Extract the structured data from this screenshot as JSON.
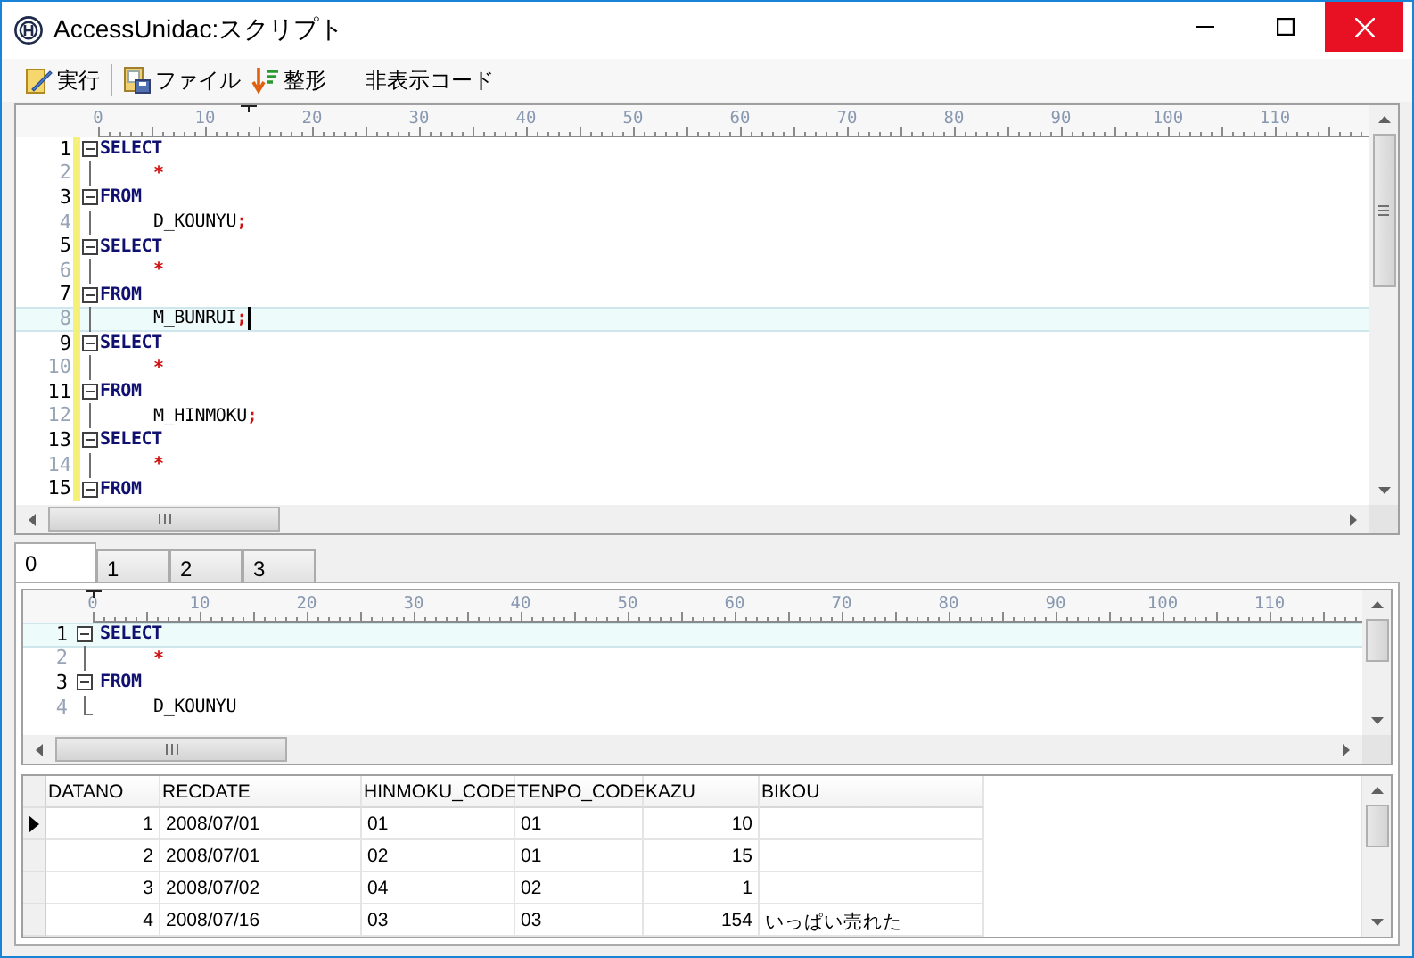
{
  "window": {
    "title": "AccessUnidac:スクリプト"
  },
  "toolbar": [
    {
      "label": "実行",
      "kind": "run"
    },
    {
      "label": "ファイル",
      "kind": "file"
    },
    {
      "label": "整形",
      "kind": "format"
    },
    {
      "label": "非表示コード",
      "kind": "plain"
    }
  ],
  "editor": {
    "change_bar": true,
    "caret": true,
    "ruler": [
      "0",
      "10",
      "20",
      "30",
      "40",
      "50",
      "60",
      "70",
      "80",
      "90",
      "100",
      "110"
    ],
    "lines": [
      {
        "no": "1",
        "kind": "head",
        "current": false,
        "tokens": [
          {
            "kind": "keyword",
            "text": "SELECT"
          }
        ]
      },
      {
        "no": "2",
        "kind": "body",
        "current": false,
        "tokens": [
          {
            "kind": "symbol",
            "text": "*"
          }
        ]
      },
      {
        "no": "3",
        "kind": "head",
        "current": false,
        "tokens": [
          {
            "kind": "keyword",
            "text": "FROM"
          }
        ]
      },
      {
        "no": "4",
        "kind": "body",
        "current": false,
        "tokens": [
          {
            "kind": "ident",
            "text": "D_KOUNYU"
          },
          {
            "kind": "symbol",
            "text": ";"
          }
        ]
      },
      {
        "no": "5",
        "kind": "head",
        "current": false,
        "tokens": [
          {
            "kind": "keyword",
            "text": "SELECT"
          }
        ]
      },
      {
        "no": "6",
        "kind": "body",
        "current": false,
        "tokens": [
          {
            "kind": "symbol",
            "text": "*"
          }
        ]
      },
      {
        "no": "7",
        "kind": "head",
        "current": false,
        "tokens": [
          {
            "kind": "keyword",
            "text": "FROM"
          }
        ]
      },
      {
        "no": "8",
        "kind": "body",
        "current": true,
        "tokens": [
          {
            "kind": "ident",
            "text": "M_BUNRUI"
          },
          {
            "kind": "symbol",
            "text": ";"
          }
        ]
      },
      {
        "no": "9",
        "kind": "head",
        "current": false,
        "tokens": [
          {
            "kind": "keyword",
            "text": "SELECT"
          }
        ]
      },
      {
        "no": "10",
        "kind": "body",
        "current": false,
        "tokens": [
          {
            "kind": "symbol",
            "text": "*"
          }
        ]
      },
      {
        "no": "11",
        "kind": "head",
        "current": false,
        "tokens": [
          {
            "kind": "keyword",
            "text": "FROM"
          }
        ]
      },
      {
        "no": "12",
        "kind": "body",
        "current": false,
        "tokens": [
          {
            "kind": "ident",
            "text": "M_HINMOKU"
          },
          {
            "kind": "symbol",
            "text": ";"
          }
        ]
      },
      {
        "no": "13",
        "kind": "head",
        "current": false,
        "tokens": [
          {
            "kind": "keyword",
            "text": "SELECT"
          }
        ]
      },
      {
        "no": "14",
        "kind": "body",
        "current": false,
        "tokens": [
          {
            "kind": "symbol",
            "text": "*"
          }
        ]
      },
      {
        "no": "15",
        "kind": "head",
        "current": false,
        "tokens": [
          {
            "kind": "keyword",
            "text": "FROM"
          }
        ]
      }
    ]
  },
  "result_tabs": [
    {
      "label": "0",
      "selected": true
    },
    {
      "label": "1",
      "selected": false
    },
    {
      "label": "2",
      "selected": false
    },
    {
      "label": "3",
      "selected": false
    }
  ],
  "result_editor": {
    "change_bar": false,
    "caret": false,
    "ruler": [
      "0",
      "10",
      "20",
      "30",
      "40",
      "50",
      "60",
      "70",
      "80",
      "90",
      "100",
      "110"
    ],
    "lines": [
      {
        "no": "1",
        "kind": "head",
        "current": true,
        "tokens": [
          {
            "kind": "keyword",
            "text": "SELECT"
          }
        ]
      },
      {
        "no": "2",
        "kind": "body",
        "current": false,
        "tokens": [
          {
            "kind": "symbol",
            "text": "*"
          }
        ]
      },
      {
        "no": "3",
        "kind": "head",
        "current": false,
        "tokens": [
          {
            "kind": "keyword",
            "text": "FROM"
          }
        ]
      },
      {
        "no": "4",
        "kind": "end",
        "current": false,
        "tokens": [
          {
            "kind": "ident",
            "text": "D_KOUNYU"
          }
        ]
      }
    ]
  },
  "grid": {
    "columns": [
      {
        "label": "DATANO",
        "kind": "number"
      },
      {
        "label": "RECDATE",
        "kind": "text"
      },
      {
        "label": "HINMOKU_CODE",
        "kind": "text"
      },
      {
        "label": "TENPO_CODE",
        "kind": "text"
      },
      {
        "label": "KAZU",
        "kind": "number"
      },
      {
        "label": "BIKOU",
        "kind": "text"
      }
    ],
    "rows": [
      {
        "selected": true,
        "cells": [
          "1",
          "2008/07/01",
          "01",
          "01",
          "10"
        ]
      },
      {
        "selected": false,
        "cells": [
          "2",
          "2008/07/01",
          "02",
          "01",
          "15"
        ]
      },
      {
        "selected": false,
        "cells": [
          "3",
          "2008/07/02",
          "04",
          "02",
          "1"
        ]
      },
      {
        "selected": false,
        "cells": [
          "4",
          "2008/07/16",
          "03",
          "03",
          "154",
          "いっぱい売れた"
        ]
      }
    ]
  }
}
